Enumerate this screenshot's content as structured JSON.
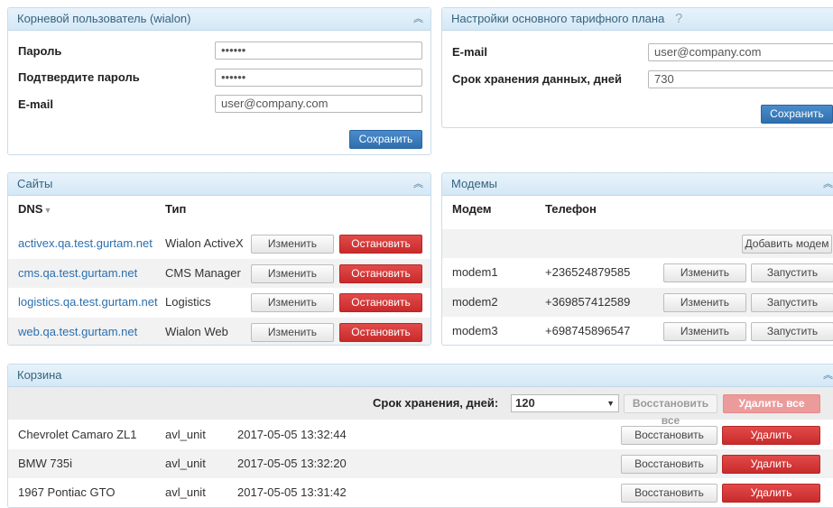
{
  "root_user": {
    "title": "Корневой пользователь (wialon)",
    "password_label": "Пароль",
    "password_value": "••••••",
    "confirm_label": "Подтвердите пароль",
    "confirm_value": "••••••",
    "email_label": "E-mail",
    "email_value": "user@company.com",
    "save_label": "Сохранить"
  },
  "plan": {
    "title": "Настройки основного тарифного плана",
    "help_icon": "?",
    "email_label": "E-mail",
    "email_value": "user@company.com",
    "retention_label": "Срок хранения данных, дней",
    "retention_value": "730",
    "save_label": "Сохранить"
  },
  "sites": {
    "title": "Сайты",
    "col_dns": "DNS",
    "col_type": "Тип",
    "edit_label": "Изменить",
    "stop_label": "Остановить",
    "rows": [
      {
        "dns": "activex.qa.test.gurtam.net",
        "type": "Wialon ActiveX"
      },
      {
        "dns": "cms.qa.test.gurtam.net",
        "type": "CMS Manager"
      },
      {
        "dns": "logistics.qa.test.gurtam.net",
        "type": "Logistics"
      },
      {
        "dns": "web.qa.test.gurtam.net",
        "type": "Wialon Web"
      }
    ]
  },
  "modems": {
    "title": "Модемы",
    "col_modem": "Модем",
    "col_phone": "Телефон",
    "add_label": "Добавить модем",
    "edit_label": "Изменить",
    "start_label": "Запустить",
    "rows": [
      {
        "name": "modem1",
        "phone": "+236524879585"
      },
      {
        "name": "modem2",
        "phone": "+369857412589"
      },
      {
        "name": "modem3",
        "phone": "+698745896547"
      }
    ]
  },
  "trash": {
    "title": "Корзина",
    "retention_label": "Срок хранения, дней:",
    "retention_value": "120",
    "restore_all_label": "Восстановить все",
    "delete_all_label": "Удалить все",
    "restore_label": "Восстановить",
    "delete_label": "Удалить",
    "rows": [
      {
        "name": "Chevrolet Camaro ZL1",
        "type": "avl_unit",
        "date": "2017-05-05 13:32:44"
      },
      {
        "name": "BMW 735i",
        "type": "avl_unit",
        "date": "2017-05-05 13:32:20"
      },
      {
        "name": "1967 Pontiac GTO",
        "type": "avl_unit",
        "date": "2017-05-05 13:31:42"
      }
    ]
  }
}
